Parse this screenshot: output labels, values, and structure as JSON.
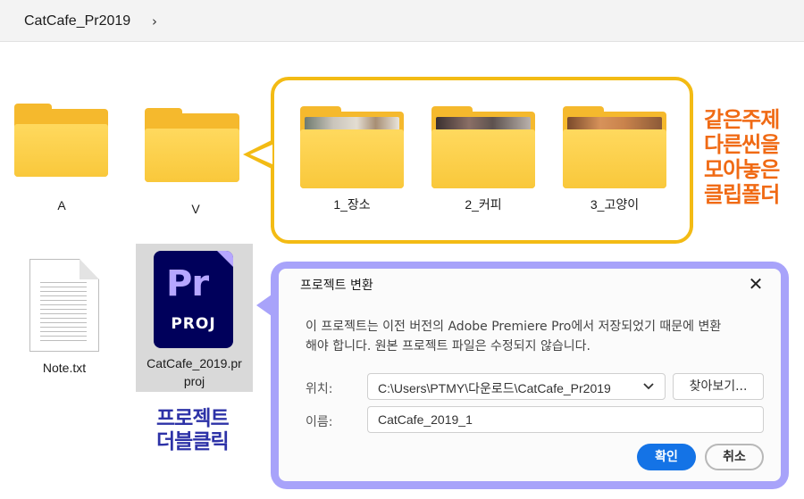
{
  "breadcrumb": {
    "current": "CatCafe_Pr2019",
    "chevron": "›"
  },
  "folders": {
    "a_label": "A",
    "v_label": "V",
    "sub": [
      {
        "label": "1_장소"
      },
      {
        "label": "2_커피"
      },
      {
        "label": "3_고양이"
      }
    ]
  },
  "annotations": {
    "orange_lines": [
      "같은주제",
      "다른씬을",
      "모아놓은",
      "클립폴더"
    ],
    "blue_lines": [
      "프로젝트",
      "더블클릭"
    ]
  },
  "files": {
    "note": "Note.txt",
    "project_name_line1": "CatCafe_2019.pr",
    "project_name_line2": "proj",
    "project_icon_glyph": "Pr",
    "project_icon_sub": "PROJ"
  },
  "dialog": {
    "title": "프로젝트 변환",
    "close": "✕",
    "message_line1": "이 프로젝트는 이전 버전의 Adobe Premiere Pro에서 저장되었기 때문에 변환",
    "message_line2": "해야 합니다.   원본 프로젝트 파일은 수정되지 않습니다.",
    "location_label": "위치:",
    "location_value": "C:\\Users\\PTMY\\다운로드\\CatCafe_Pr2019",
    "browse_label": "찾아보기...",
    "name_label": "이름:",
    "name_value": "CatCafe_2019_1",
    "ok_label": "확인",
    "cancel_label": "취소"
  },
  "colors": {
    "callout_border": "#f3bb14",
    "orange_text": "#f06a14",
    "blue_text": "#2d32a7",
    "dialog_frame": "#a8a3fa",
    "primary_button": "#1473e6",
    "premiere_bg": "#00005b",
    "premiere_accent": "#b6a6ff"
  }
}
